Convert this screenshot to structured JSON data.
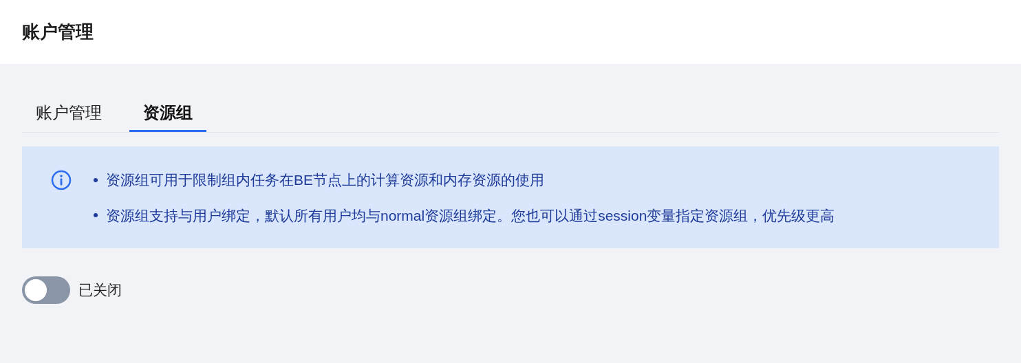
{
  "header": {
    "title": "账户管理"
  },
  "tabs": [
    {
      "label": "账户管理",
      "selected": false
    },
    {
      "label": "资源组",
      "selected": true
    }
  ],
  "notice": {
    "items": [
      "资源组可用于限制组内任务在BE节点上的计算资源和内存资源的使用",
      "资源组支持与用户绑定，默认所有用户均与normal资源组绑定。您也可以通过session变量指定资源组，优先级更高"
    ]
  },
  "toggle": {
    "on": false,
    "label": "已关闭"
  }
}
